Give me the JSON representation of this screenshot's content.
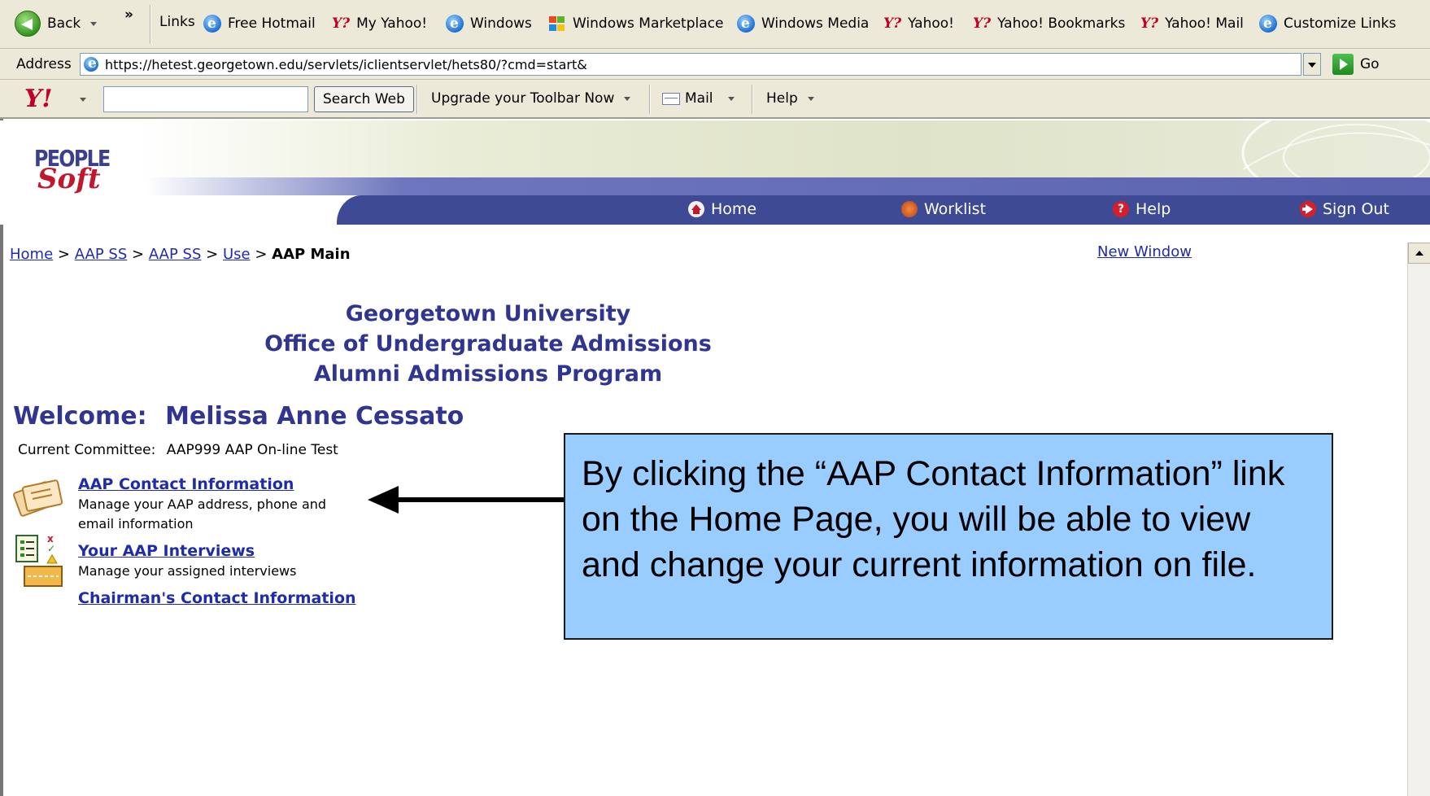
{
  "browser": {
    "back_label": "Back",
    "chevron": "»",
    "links_label": "Links",
    "links": [
      {
        "label": "Free Hotmail",
        "icon": "ie-icon"
      },
      {
        "label": "My Yahoo!",
        "icon": "yahoo-icon"
      },
      {
        "label": "Windows",
        "icon": "ie-icon"
      },
      {
        "label": "Windows Marketplace",
        "icon": "windows-logo-icon"
      },
      {
        "label": "Windows Media",
        "icon": "ie-icon"
      },
      {
        "label": "Yahoo!",
        "icon": "yahoo-icon"
      },
      {
        "label": "Yahoo! Bookmarks",
        "icon": "yahoo-icon"
      },
      {
        "label": "Yahoo! Mail",
        "icon": "yahoo-icon"
      },
      {
        "label": "Customize Links",
        "icon": "ie-icon"
      }
    ],
    "address_label": "Address",
    "url": "https://hetest.georgetown.edu/servlets/iclientservlet/hets80/?cmd=start&",
    "go_label": "Go"
  },
  "yahoo_toolbar": {
    "logo": "Y!",
    "search_value": "",
    "search_button": "Search Web",
    "upgrade": "Upgrade your Toolbar Now",
    "mail": "Mail",
    "help": "Help"
  },
  "peoplesoft": {
    "logo_top": "PEOPLE",
    "logo_bottom": "Soft",
    "nav": [
      {
        "label": "Home",
        "icon": "home-icon"
      },
      {
        "label": "Worklist",
        "icon": "worklist-icon"
      },
      {
        "label": "Help",
        "icon": "help-icon"
      },
      {
        "label": "Sign Out",
        "icon": "sign-out-icon"
      }
    ]
  },
  "breadcrumb": {
    "items": [
      "Home",
      "AAP SS",
      "AAP SS",
      "Use"
    ],
    "sep": ">",
    "current": "AAP Main"
  },
  "new_window": "New Window",
  "heading": {
    "line1": "Georgetown University",
    "line2": "Office of Undergraduate Admissions",
    "line3": "Alumni Admissions Program"
  },
  "welcome": {
    "label": "Welcome:",
    "name": "Melissa Anne Cessato"
  },
  "committee": {
    "label": "Current Committee:",
    "value": "AAP999 AAP On-line Test"
  },
  "menu": [
    {
      "link": "AAP Contact Information",
      "desc": "Manage your AAP address, phone and email information"
    },
    {
      "link": "Your AAP Interviews",
      "desc": "Manage your assigned interviews"
    },
    {
      "link": "Chairman's Contact Information",
      "desc": ""
    }
  ],
  "callout": {
    "text": "By clicking the “AAP Contact Information” link on the Home Page, you will be able to view and change your current information on file."
  }
}
